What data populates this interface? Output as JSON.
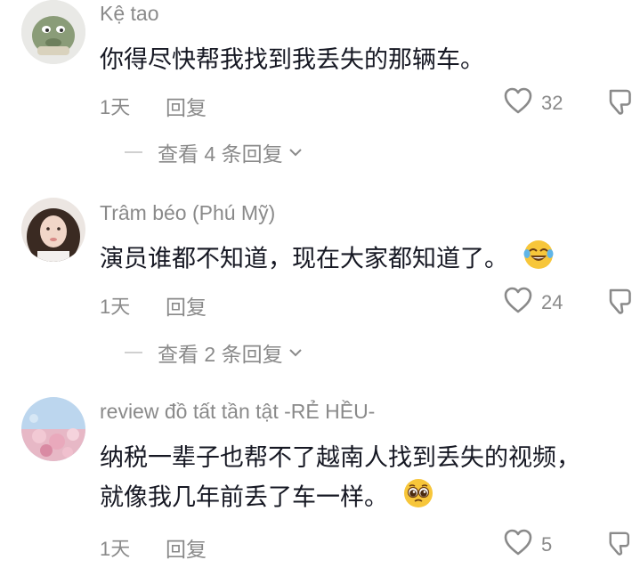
{
  "comments": [
    {
      "username": "Kệ tao",
      "lines": [
        "你得尽快帮我找到我丢失的那辆车。"
      ],
      "time": "1天",
      "reply": "回复",
      "likes": "32",
      "view_replies": "查看 4 条回复"
    },
    {
      "username": "Trâm béo (Phú Mỹ)",
      "lines": [
        "演员谁都不知道，现在大家都知道了。"
      ],
      "emoji": "laughing-tears-emoji",
      "time": "1天",
      "reply": "回复",
      "likes": "24",
      "view_replies": "查看 2 条回复"
    },
    {
      "username": "review đồ tất tần tật -RẺ HỀU-",
      "lines": [
        "纳税一辈子也帮不了越南人找到丢失的视频，",
        "就像我几年前丢了车一样。"
      ],
      "emoji": "pleading-face-emoji",
      "time": "1天",
      "reply": "回复",
      "likes": "5"
    }
  ],
  "icons": {
    "like": "heart-outline-icon",
    "dislike": "thumbs-down-icon",
    "expand": "chevron-down-icon"
  }
}
